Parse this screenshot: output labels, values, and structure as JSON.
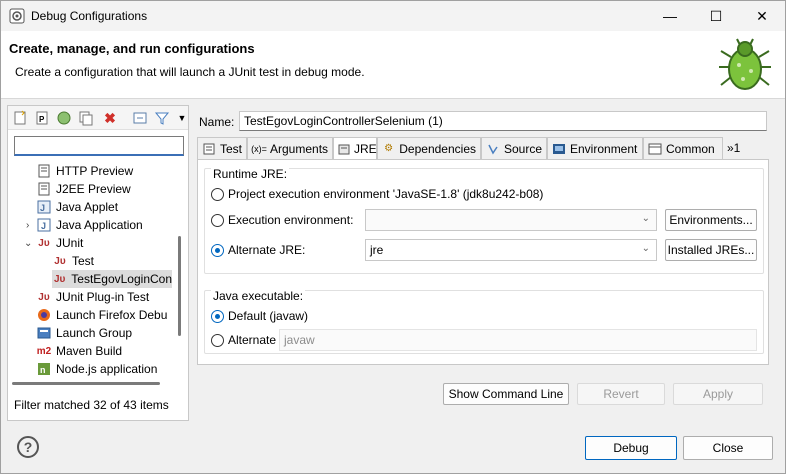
{
  "window": {
    "title": "Debug Configurations"
  },
  "header": {
    "title": "Create, manage, and run configurations",
    "description": "Create a configuration that will launch a JUnit test in debug mode."
  },
  "left": {
    "filter_placeholder": "",
    "tree": [
      {
        "label": "HTTP Preview",
        "icon": "http-preview-icon"
      },
      {
        "label": "J2EE Preview",
        "icon": "j2ee-preview-icon"
      },
      {
        "label": "Java Applet",
        "icon": "java-applet-icon"
      },
      {
        "label": "Java Application",
        "icon": "java-application-icon"
      },
      {
        "label": "JUnit",
        "icon": "junit-icon"
      },
      {
        "label": "Test",
        "icon": "junit-icon"
      },
      {
        "label": "TestEgovLoginCon",
        "icon": "junit-icon"
      },
      {
        "label": "JUnit Plug-in Test",
        "icon": "junit-plugin-icon"
      },
      {
        "label": "Launch Firefox Debu",
        "icon": "firefox-icon"
      },
      {
        "label": "Launch Group",
        "icon": "launch-group-icon"
      },
      {
        "label": "Maven Build",
        "icon": "maven-icon"
      },
      {
        "label": "Node.js application",
        "icon": "nodejs-icon"
      }
    ],
    "status": "Filter matched 32 of 43 items"
  },
  "config": {
    "name_label": "Name:",
    "name_value": "TestEgovLoginControllerSelenium (1)",
    "tabs": [
      {
        "label": "Test",
        "icon": "test-tab-icon"
      },
      {
        "label": "Arguments",
        "icon": "arguments-tab-icon"
      },
      {
        "label": "JRE",
        "icon": "jre-tab-icon"
      },
      {
        "label": "Dependencies",
        "icon": "dependencies-tab-icon"
      },
      {
        "label": "Source",
        "icon": "source-tab-icon"
      },
      {
        "label": "Environment",
        "icon": "environment-tab-icon"
      },
      {
        "label": "Common",
        "icon": "common-tab-icon"
      },
      {
        "label": "»1",
        "icon": "overflow-tab-icon"
      }
    ],
    "runtime_jre": {
      "title": "Runtime JRE:",
      "project_env": "Project execution environment 'JavaSE-1.8' (jdk8u242-b08)",
      "exec_env": "Execution environment:",
      "exec_env_value": "",
      "environments_button": "Environments...",
      "alternate_jre": "Alternate JRE:",
      "alternate_jre_value": "jre",
      "installed_jres_button": "Installed JREs..."
    },
    "java_executable": {
      "title": "Java executable:",
      "default": "Default (javaw)",
      "alternate": "Alternate",
      "alternate_value": "javaw"
    },
    "show_cmd_button": "Show Command Line",
    "revert_button": "Revert",
    "apply_button": "Apply"
  },
  "footer": {
    "debug_button": "Debug",
    "close_button": "Close"
  }
}
